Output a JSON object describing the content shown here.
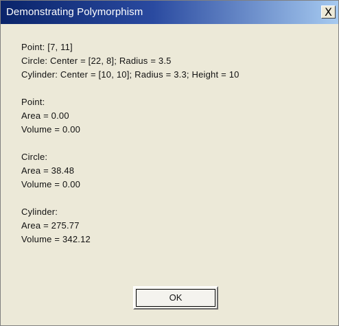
{
  "window": {
    "title": "Demonstrating Polymorphism",
    "close_glyph": "X"
  },
  "message": {
    "line1": "Point: [7, 11]",
    "line2": "Circle: Center = [22, 8]; Radius = 3.5",
    "line3": "Cylinder: Center = [10, 10]; Radius = 3.3; Height = 10",
    "line4": "Point:",
    "line5": "Area = 0.00",
    "line6": "Volume = 0.00",
    "line7": "Circle:",
    "line8": "Area = 38.48",
    "line9": "Volume = 0.00",
    "line10": "Cylinder:",
    "line11": "Area = 275.77",
    "line12": "Volume = 342.12"
  },
  "ok_button": {
    "label": "OK"
  },
  "colors": {
    "titlebar_start": "#0a246a",
    "titlebar_end": "#a6caf0",
    "dialog_bg": "#ece9d8"
  }
}
